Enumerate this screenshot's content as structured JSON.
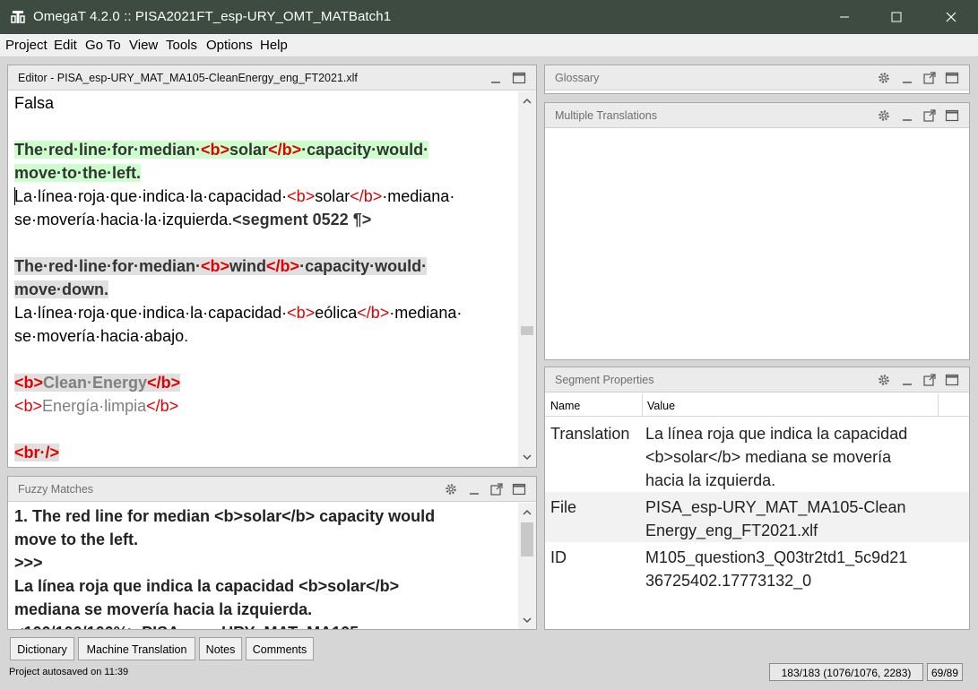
{
  "window": {
    "title": "OmegaT 4.2.0 :: PISA2021FT_esp-URY_OMT_MATBatch1",
    "title_bar_color": "#3d4b40"
  },
  "menu": [
    "Project",
    "Edit",
    "Go To",
    "View",
    "Tools",
    "Options",
    "Help"
  ],
  "editor": {
    "title": "Editor - PISA_esp-URY_MAT_MA105-CleanEnergy_eng_FT2021.xlf",
    "lines": [
      [
        {
          "t": "Falsa",
          "c": ""
        }
      ],
      [
        {
          "t": "The·red·line·for·median·",
          "c": "src hl-green"
        },
        {
          "t": "<b>",
          "c": "src hl-green tag"
        },
        {
          "t": "solar",
          "c": "src hl-green"
        },
        {
          "t": "</b>",
          "c": "src hl-green tag"
        },
        {
          "t": "·capacity·would·",
          "c": "src hl-green"
        }
      ],
      [
        {
          "t": "move·to·the·left.",
          "c": "src hl-green"
        }
      ],
      [
        {
          "t": "La·línea·roja·que·indica·la·capacidad·",
          "c": ""
        },
        {
          "t": "<b>",
          "c": "tag"
        },
        {
          "t": "solar",
          "c": ""
        },
        {
          "t": "</b>",
          "c": "tag"
        },
        {
          "t": "·mediana·",
          "c": ""
        }
      ],
      [
        {
          "t": "se·movería·hacia·la·izquierda.",
          "c": ""
        },
        {
          "t": "<segment 0522 ¶>",
          "c": "src"
        }
      ],
      [
        {
          "t": "The·red·line·for·median·",
          "c": "src hl-grey"
        },
        {
          "t": "<b>",
          "c": "src hl-grey tag"
        },
        {
          "t": "wind",
          "c": "src hl-grey"
        },
        {
          "t": "</b>",
          "c": "src hl-grey tag"
        },
        {
          "t": "·capacity·would·",
          "c": "src hl-grey"
        }
      ],
      [
        {
          "t": "move·down.",
          "c": "src hl-grey"
        }
      ],
      [
        {
          "t": "La·línea·roja·que·indica·la·capacidad·",
          "c": ""
        },
        {
          "t": "<b>",
          "c": "tag"
        },
        {
          "t": "eólica",
          "c": ""
        },
        {
          "t": "</b>",
          "c": "tag"
        },
        {
          "t": "·mediana·",
          "c": ""
        }
      ],
      [
        {
          "t": "se·movería·hacia·abajo.",
          "c": ""
        }
      ],
      [
        {
          "t": "<b>",
          "c": "src hl-grey tag"
        },
        {
          "t": "Clean·Energy",
          "c": "src hl-grey gray"
        },
        {
          "t": "</b>",
          "c": "src hl-grey tag"
        }
      ],
      [
        {
          "t": "<b>",
          "c": "tag"
        },
        {
          "t": "Energía·limpia",
          "c": "gray"
        },
        {
          "t": "</b>",
          "c": "tag"
        }
      ],
      [
        {
          "t": "<br·/>",
          "c": "src hl-grey tag"
        }
      ],
      [
        {
          "t": "<br·/>",
          "c": "tag"
        }
      ]
    ]
  },
  "fuzzy": {
    "title": "Fuzzy Matches",
    "lines": [
      "1. The red line for median <b>solar</b> capacity would",
      "move to the left.",
      ">>>",
      "La línea roja que indica la capacidad <b>solar</b>",
      "mediana se movería hacia la izquierda.",
      "<100/100/100%> PISA_esp-URY_MAT_MA105-"
    ]
  },
  "glossary": {
    "title": "Glossary"
  },
  "multiple_translations": {
    "title": "Multiple Translations"
  },
  "segment_properties": {
    "title": "Segment Properties",
    "col_name": "Name",
    "col_value": "Value",
    "rows": [
      {
        "name": "Translation",
        "value": "La línea roja que indica la capacidad\n<b>solar</b> mediana se movería\nhacia la izquierda."
      },
      {
        "name": "File",
        "value": "PISA_esp-URY_MAT_MA105-Clean\nEnergy_eng_FT2021.xlf"
      },
      {
        "name": "ID",
        "value": "M105_question3_Q03tr2td1_5c9d21\n36725402.17773132_0"
      }
    ]
  },
  "bottom_tabs": [
    "Dictionary",
    "Machine Translation",
    "Notes",
    "Comments"
  ],
  "status": {
    "message": "Project autosaved on 11:39",
    "progress": "183/183 (1076/1076, 2283)",
    "segment": "69/89"
  },
  "icons": [
    "omegat-app-icon",
    "minimize-icon",
    "maximize-icon",
    "close-icon",
    "gear-icon",
    "pane-minimize-icon",
    "undock-icon",
    "pane-maximize-icon"
  ],
  "colors": {
    "tag": "#e00000",
    "active_segment": "#ccffcc",
    "source_segment": "#e0e0e0"
  }
}
